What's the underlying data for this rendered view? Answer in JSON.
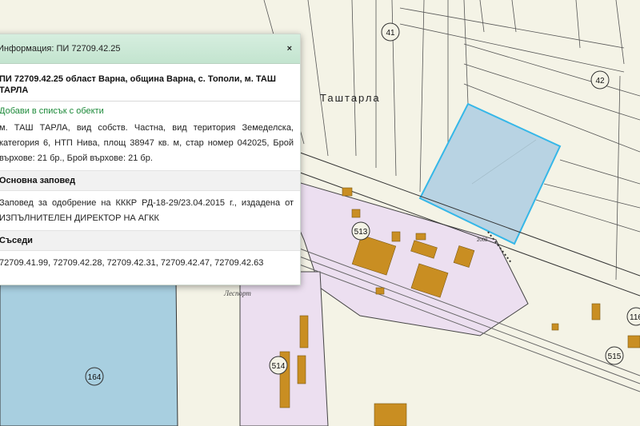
{
  "map": {
    "place_label": "Таштарла",
    "area_label": "Леспорт",
    "road_number": "2008",
    "parcel_numbers": [
      "41",
      "42",
      "513",
      "514",
      "515",
      "164",
      "116"
    ]
  },
  "popup": {
    "title": "Информация: ПИ 72709.42.25",
    "close_label": "×",
    "heading": "ПИ 72709.42.25 област Варна, община Варна, с. Тополи, м. ТАШ ТАРЛА",
    "add_link": "Добави в списък с обекти",
    "description": "м. ТАШ ТАРЛА, вид собств. Частна, вид територия Земеделска, категория 6, НТП Нива, площ 38947 кв. м, стар номер 042025, Брой върхове: 21 бр., Брой върхове: 21 бр.",
    "order_heading": "Основна заповед",
    "order_text": "Заповед за одобрение на КККР РД-18-29/23.04.2015 г., издадена от ИЗПЪЛНИТЕЛЕН ДИРЕКТОР НА АГКК",
    "neighbors_heading": "Съседи",
    "neighbors_text": "72709.41.99, 72709.42.28, 72709.42.31, 72709.42.47, 72709.42.63"
  },
  "colors": {
    "background": "#f4f3e6",
    "industrial": "#ecdff0",
    "water": "#a8cfe0",
    "highlight_fill": "#b8d3e3",
    "highlight_stroke": "#35b7e8",
    "building": "#c98e22"
  }
}
